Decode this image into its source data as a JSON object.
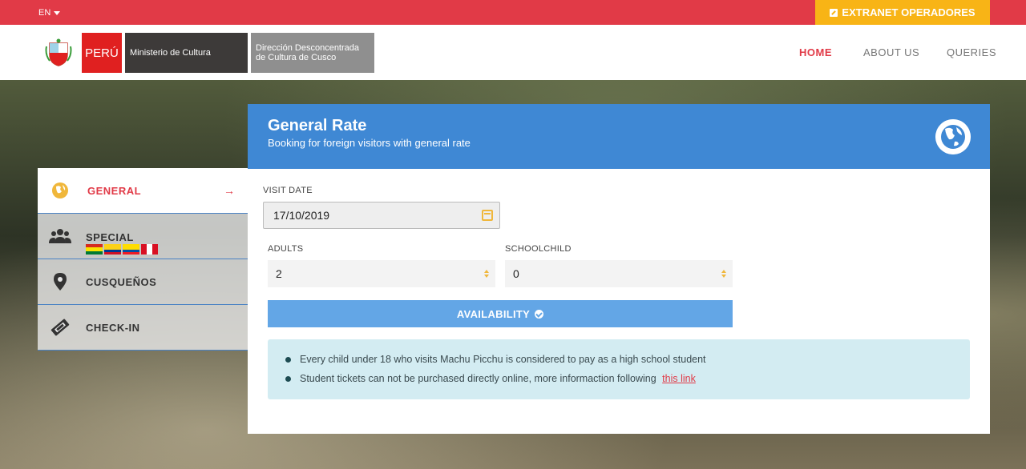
{
  "topbar": {
    "language": "EN",
    "extranet_label": "EXTRANET OPERADORES"
  },
  "header": {
    "brand_peru": "PERÚ",
    "brand_ministry": "Ministerio de Cultura",
    "brand_direction_line1": "Dirección Desconcentrada",
    "brand_direction_line2": "de Cultura de Cusco",
    "nav": [
      {
        "label": "HOME",
        "active": true
      },
      {
        "label": "ABOUT US",
        "active": false
      },
      {
        "label": "QUERIES",
        "active": false
      }
    ]
  },
  "sidebar": {
    "items": [
      {
        "label": "GENERAL",
        "icon": "globe-icon",
        "active": true
      },
      {
        "label": "SPECIAL",
        "icon": "group-icon",
        "active": false
      },
      {
        "label": "CUSQUEÑOS",
        "icon": "map-pin-icon",
        "active": false
      },
      {
        "label": "CHECK-IN",
        "icon": "ticket-icon",
        "active": false
      }
    ]
  },
  "panel": {
    "title": "General Rate",
    "subtitle": "Booking for foreign visitors with general rate",
    "visit_date_label": "VISIT DATE",
    "visit_date_value": "17/10/2019",
    "adults_label": "ADULTS",
    "adults_value": "2",
    "schoolchild_label": "SCHOOLCHILD",
    "schoolchild_value": "0",
    "availability_label": "AVAILABILITY",
    "notices": [
      "Every child under 18 who visits Machu Picchu is considered to pay as a high school student",
      "Student tickets can not be purchased directly online, more informaction following"
    ],
    "notice_link": "this link"
  },
  "colors": {
    "accent_red": "#e13a47",
    "accent_yellow": "#f8b416",
    "panel_blue": "#3f88d4",
    "button_blue": "#63a6e6"
  }
}
